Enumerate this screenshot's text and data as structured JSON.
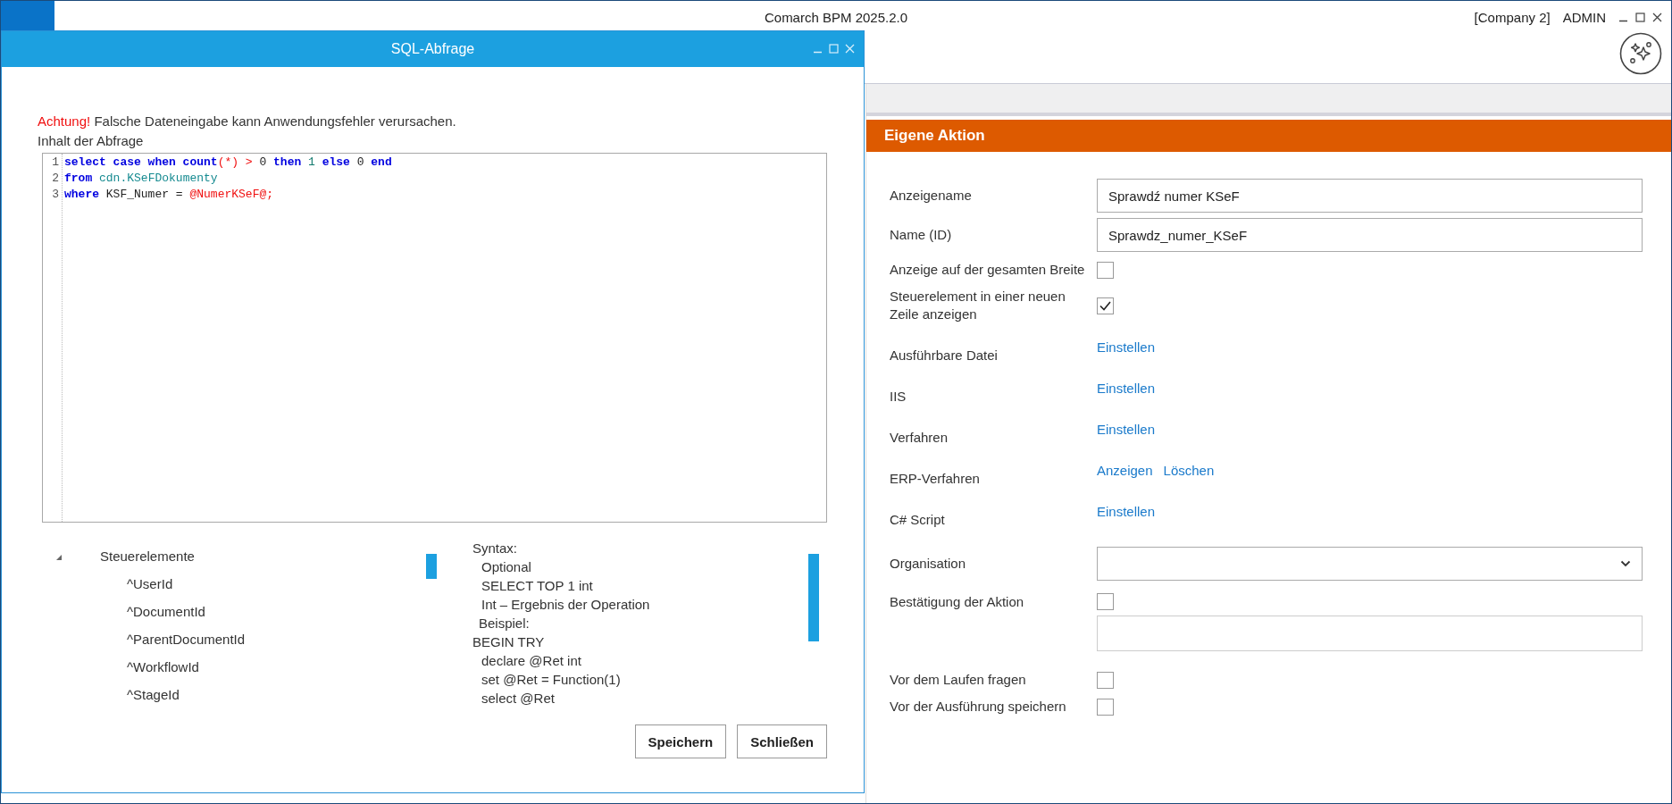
{
  "app": {
    "title": "Comarch BPM 2025.2.0",
    "company": "[Company 2]",
    "user": "ADMIN"
  },
  "panel": {
    "title": "Eigene Aktion",
    "rows": [
      {
        "kind": "text",
        "label": "Anzeigename",
        "value": "Sprawdź numer KSeF"
      },
      {
        "kind": "text",
        "label": "Name (ID)",
        "value": "Sprawdz_numer_KSeF"
      },
      {
        "kind": "checkbox",
        "label": "Anzeige auf der gesamten Breite",
        "checked": false
      },
      {
        "kind": "checkbox",
        "label": "Steuerelement in einer neuen Zeile anzeigen",
        "checked": true
      },
      {
        "kind": "links",
        "label": "Ausführbare Datei",
        "links": [
          "Einstellen"
        ]
      },
      {
        "kind": "links",
        "label": "IIS",
        "links": [
          "Einstellen"
        ]
      },
      {
        "kind": "links",
        "label": "Verfahren",
        "links": [
          "Einstellen"
        ]
      },
      {
        "kind": "links",
        "label": "ERP-Verfahren",
        "links": [
          "Anzeigen",
          "Löschen"
        ]
      },
      {
        "kind": "links",
        "label": "C# Script",
        "links": [
          "Einstellen"
        ]
      },
      {
        "kind": "select",
        "label": "Organisation"
      },
      {
        "kind": "checkbox-field",
        "label": "Bestätigung der Aktion",
        "checked": false
      },
      {
        "kind": "checkbox",
        "label": "Vor dem Laufen fragen",
        "checked": false
      },
      {
        "kind": "checkbox",
        "label": "Vor der Ausführung speichern",
        "checked": false
      }
    ]
  },
  "dialog": {
    "title": "SQL-Abfrage",
    "warning_label": "Achtung!",
    "warning": "Falsche Dateneingabe kann Anwendungsfehler verursachen.",
    "editor_label": "Inhalt der Abfrage",
    "code": [
      {
        "number": "1",
        "tokens": [
          {
            "kind": "kw",
            "text": "select case when count"
          },
          {
            "kind": "op",
            "text": "(*) >"
          },
          {
            "kind": "plain",
            "text": " 0 "
          },
          {
            "kind": "kw",
            "text": "then"
          },
          {
            "kind": "num",
            "text": " 1 "
          },
          {
            "kind": "kw",
            "text": "else"
          },
          {
            "kind": "plain",
            "text": " 0 "
          },
          {
            "kind": "kw",
            "text": "end"
          }
        ]
      },
      {
        "number": "2",
        "tokens": [
          {
            "kind": "kw",
            "text": "from"
          },
          {
            "kind": "ident",
            "text": " cdn.KSeFDokumenty"
          }
        ]
      },
      {
        "number": "3",
        "tokens": [
          {
            "kind": "kw",
            "text": "where"
          },
          {
            "kind": "plain",
            "text": " KSF_Numer = "
          },
          {
            "kind": "op",
            "text": "@NumerKSeF@;"
          }
        ]
      }
    ],
    "tree": [
      {
        "label": "Steuerelemente",
        "expanded": true,
        "children": [
          {
            "label": "^UserId"
          },
          {
            "label": "^DocumentId"
          },
          {
            "label": "^ParentDocumentId"
          },
          {
            "label": "^WorkflowId"
          },
          {
            "label": "^StageId"
          }
        ]
      }
    ],
    "syntax": [
      {
        "kind": "plain",
        "text": "Syntax:"
      },
      {
        "kind": "indent",
        "text": "Optional"
      },
      {
        "kind": "indent",
        "text": "SELECT TOP 1 int"
      },
      {
        "kind": "indent",
        "text": "Int – Ergebnis der Operation"
      },
      {
        "kind": "half",
        "text": "Beispiel:"
      },
      {
        "kind": "plain",
        "text": "BEGIN TRY"
      },
      {
        "kind": "indent",
        "text": "declare @Ret int"
      },
      {
        "kind": "indent",
        "text": "set @Ret = Function(1)"
      },
      {
        "kind": "indent",
        "text": "select @Ret"
      }
    ],
    "buttons": [
      "Speichern",
      "Schließen"
    ]
  }
}
